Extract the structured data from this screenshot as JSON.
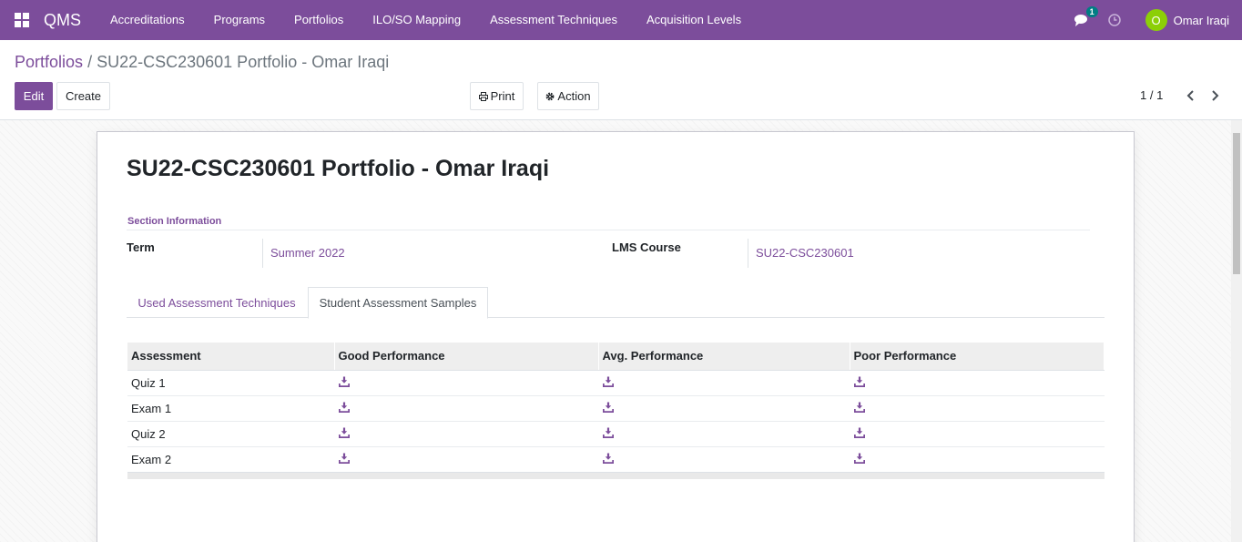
{
  "navbar": {
    "brand": "QMS",
    "menu": [
      "Accreditations",
      "Programs",
      "Portfolios",
      "ILO/SO Mapping",
      "Assessment Techniques",
      "Acquisition Levels"
    ],
    "messages_count": "1",
    "user": {
      "initial": "O",
      "name": "Omar Iraqi",
      "avatar_color": "#8ccf08"
    },
    "color": "#7c4d9b"
  },
  "breadcrumb": {
    "parent": "Portfolios",
    "separator": "/",
    "current": "SU22-CSC230601 Portfolio - Omar Iraqi"
  },
  "buttons": {
    "edit": "Edit",
    "create": "Create",
    "print": "Print",
    "action": "Action"
  },
  "pager": {
    "value": "1 / 1"
  },
  "form": {
    "title": "SU22-CSC230601 Portfolio - Omar Iraqi",
    "section_title": "Section Information",
    "term_label": "Term",
    "term_value": "Summer 2022",
    "lms_label": "LMS Course",
    "lms_value": "SU22-CSC230601"
  },
  "tabs": [
    "Used Assessment Techniques",
    "Student Assessment Samples"
  ],
  "active_tab": "Student Assessment Samples",
  "table": {
    "headers": [
      "Assessment",
      "Good Performance",
      "Avg. Performance",
      "Poor Performance"
    ],
    "rows": [
      "Quiz 1",
      "Exam 1",
      "Quiz 2",
      "Exam 2"
    ],
    "cell_icon": "download-icon"
  }
}
